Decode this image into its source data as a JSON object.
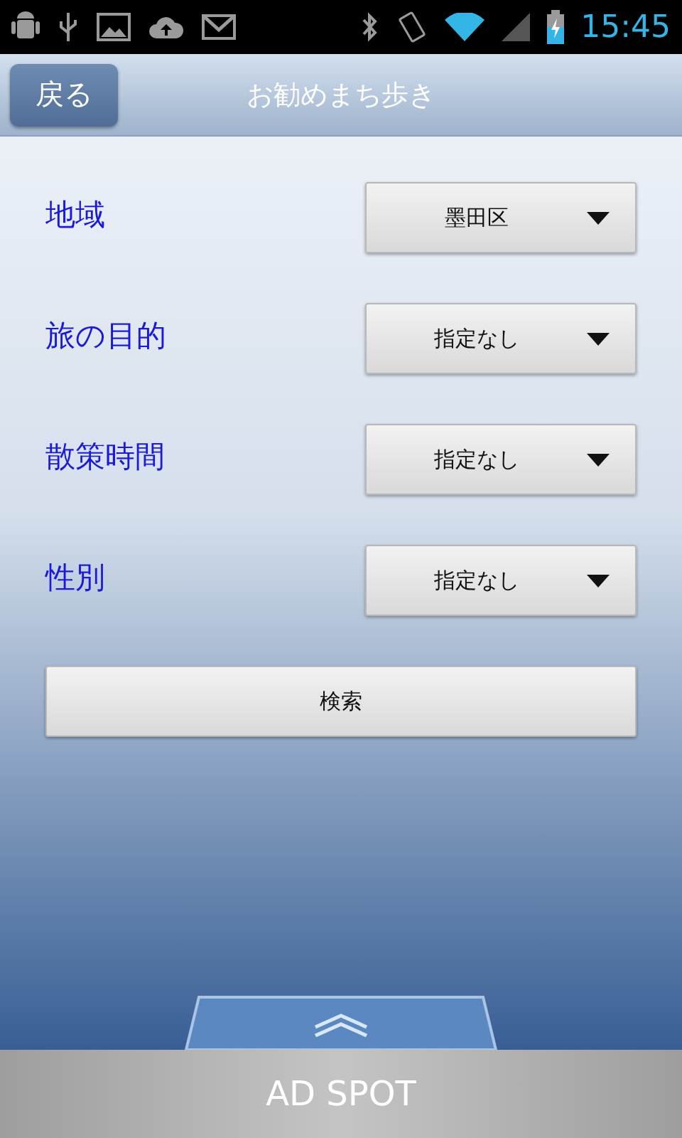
{
  "status_bar": {
    "time": "15:45"
  },
  "header": {
    "back_button": "戻る",
    "title": "お勧めまち歩き"
  },
  "fields": [
    {
      "label": "地域",
      "value": "墨田区"
    },
    {
      "label": "旅の目的",
      "value": "指定なし"
    },
    {
      "label": "散策時間",
      "value": "指定なし"
    },
    {
      "label": "性別",
      "value": "指定なし"
    }
  ],
  "search_button": "検索",
  "ad_bar": {
    "label": "AD SPOT"
  }
}
